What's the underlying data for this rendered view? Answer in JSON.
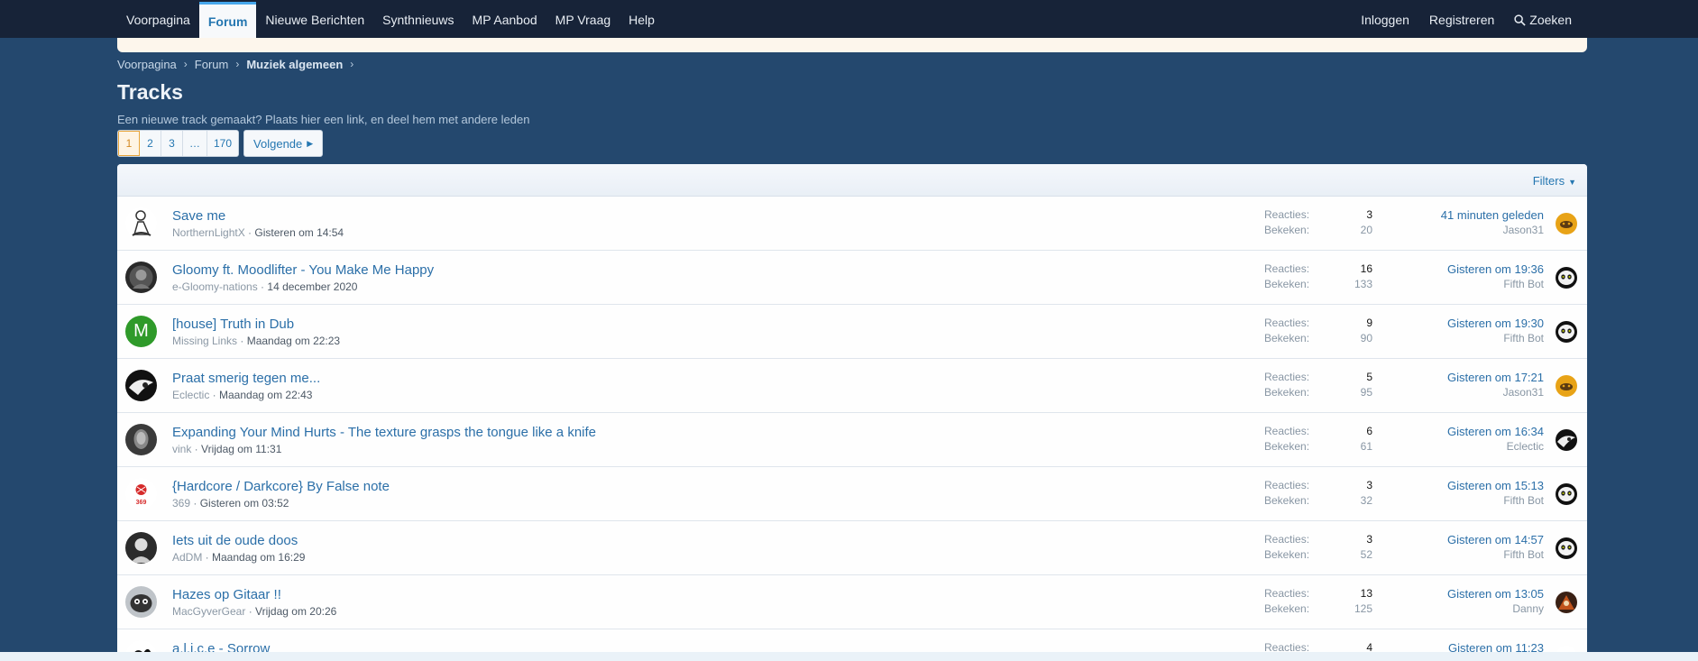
{
  "nav": {
    "tabs": [
      {
        "label": "Voorpagina"
      },
      {
        "label": "Forum",
        "active": true
      },
      {
        "label": "Nieuwe Berichten"
      },
      {
        "label": "Synthnieuws"
      },
      {
        "label": "MP Aanbod"
      },
      {
        "label": "MP Vraag"
      },
      {
        "label": "Help"
      }
    ],
    "login": "Inloggen",
    "register": "Registreren",
    "search": "Zoeken",
    "search_icon": "search-icon"
  },
  "breadcrumb": [
    "Voorpagina",
    "Forum",
    "Muziek algemeen"
  ],
  "page": {
    "title": "Tracks",
    "description": "Een nieuwe track gemaakt? Plaats hier een link, en deel hem met andere leden"
  },
  "pagination": {
    "pages": [
      "1",
      "2",
      "3",
      "…",
      "170"
    ],
    "current": "1",
    "next": "Volgende"
  },
  "list": {
    "filters": "Filters",
    "replies_label": "Reacties:",
    "views_label": "Bekeken:"
  },
  "threads": [
    {
      "title": "Save me",
      "author": "NorthernLightX",
      "date": "Gisteren om 14:54",
      "replies": "3",
      "views": "20",
      "last_date": "41 minuten geleden",
      "last_user": "Jason31"
    },
    {
      "title": "Gloomy ft. Moodlifter - You Make Me Happy",
      "author": "e-Gloomy-nations",
      "date": "14 december 2020",
      "replies": "16",
      "views": "133",
      "last_date": "Gisteren om 19:36",
      "last_user": "Fifth Bot"
    },
    {
      "title": "[house] Truth in Dub",
      "author": "Missing Links",
      "date": "Maandag om 22:23",
      "replies": "9",
      "views": "90",
      "last_date": "Gisteren om 19:30",
      "last_user": "Fifth Bot",
      "avatar_letter": "M"
    },
    {
      "title": "Praat smerig tegen me...",
      "author": "Eclectic",
      "date": "Maandag om 22:43",
      "replies": "5",
      "views": "95",
      "last_date": "Gisteren om 17:21",
      "last_user": "Jason31"
    },
    {
      "title": "Expanding Your Mind Hurts - The texture grasps the tongue like a knife",
      "author": "vink",
      "date": "Vrijdag om 11:31",
      "replies": "6",
      "views": "61",
      "last_date": "Gisteren om 16:34",
      "last_user": "Eclectic"
    },
    {
      "title": "{Hardcore / Darkcore} By False note",
      "author": "369",
      "date": "Gisteren om 03:52",
      "replies": "3",
      "views": "32",
      "last_date": "Gisteren om 15:13",
      "last_user": "Fifth Bot"
    },
    {
      "title": "Iets uit de oude doos",
      "author": "AdDM",
      "date": "Maandag om 16:29",
      "replies": "3",
      "views": "52",
      "last_date": "Gisteren om 14:57",
      "last_user": "Fifth Bot"
    },
    {
      "title": "Hazes op Gitaar !!",
      "author": "MacGyverGear",
      "date": "Vrijdag om 20:26",
      "replies": "13",
      "views": "125",
      "last_date": "Gisteren om 13:05",
      "last_user": "Danny"
    },
    {
      "title": "a.l.i.c.e - Sorrow",
      "author": "",
      "date": "",
      "replies": "4",
      "views": "",
      "last_date": "Gisteren om 11:23",
      "last_user": ""
    }
  ],
  "colors": {
    "background": "#24486e",
    "topbar": "#172338",
    "link": "#2b6fa8",
    "accent": "#47a7eb"
  }
}
